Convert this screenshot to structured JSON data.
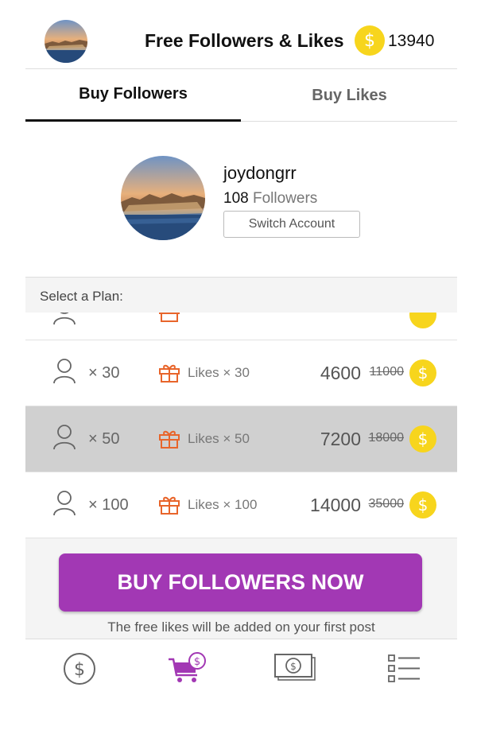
{
  "header": {
    "title": "Free Followers & Likes",
    "coin_symbol": "$",
    "coin_balance": "13940"
  },
  "tabs": [
    {
      "label": "Buy Followers",
      "active": true
    },
    {
      "label": "Buy Likes",
      "active": false
    }
  ],
  "profile": {
    "username": "joydongrr",
    "followers_count": "108",
    "followers_word": "Followers",
    "switch_label": "Switch Account"
  },
  "plans": {
    "label": "Select a Plan:",
    "items": [
      {
        "count": "× 30",
        "likes": "Likes × 30",
        "price": "4600",
        "old_price": "11000",
        "selected": false
      },
      {
        "count": "× 50",
        "likes": "Likes × 50",
        "price": "7200",
        "old_price": "18000",
        "selected": true
      },
      {
        "count": "× 100",
        "likes": "Likes × 100",
        "price": "14000",
        "old_price": "35000",
        "selected": false
      }
    ]
  },
  "buy": {
    "button_label": "BUY FOLLOWERS NOW",
    "note": "The free likes will be added on your first post"
  },
  "bottom_nav": [
    {
      "icon": "coin-circle-icon",
      "active": false
    },
    {
      "icon": "cart-coin-icon",
      "active": true
    },
    {
      "icon": "banknote-icon",
      "active": false
    },
    {
      "icon": "list-icon",
      "active": false
    }
  ],
  "colors": {
    "accent": "#a238b4",
    "coin": "#f7d51d",
    "gift": "#e8652b",
    "selected_row": "#d0d0d0"
  }
}
